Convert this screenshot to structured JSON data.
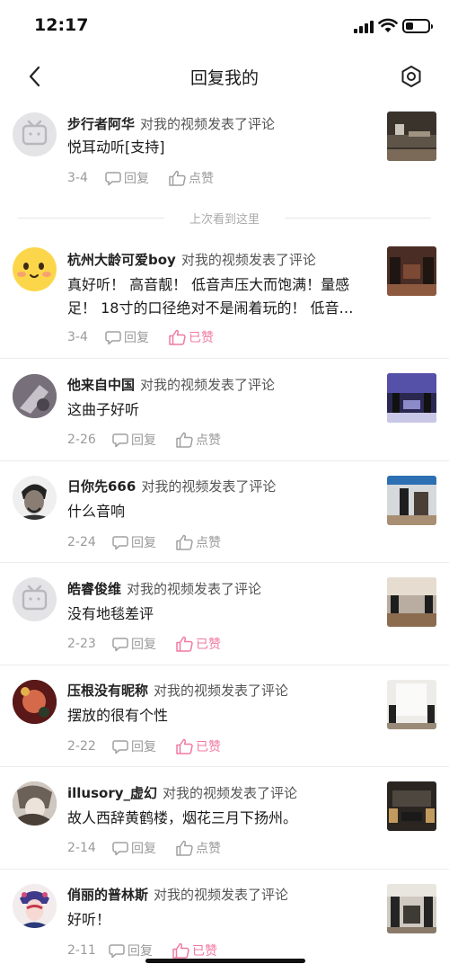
{
  "status_bar": {
    "time": "12:17"
  },
  "nav": {
    "title": "回复我的"
  },
  "divider": {
    "text": "上次看到这里"
  },
  "action_text": "对我的视频发表了评论",
  "reply_label": "回复",
  "like_label": "点赞",
  "liked_label": "已赞",
  "colors": {
    "liked": "#f07aa0",
    "muted": "#9a9a9a"
  },
  "items": [
    {
      "name": "步行者阿华",
      "comment": "悦耳动听[支持]",
      "date": "3-4",
      "liked": false,
      "avatar_icon": "tv-placeholder-icon"
    },
    {
      "name": "杭州大龄可爱boy",
      "comment": "真好听！ 高音靓！ 低音声压大而饱满！量感足！ 18寸的口径绝对不是闹着玩的！ 低音…",
      "date": "3-4",
      "liked": true,
      "avatar_icon": "smiley-face-icon"
    },
    {
      "name": "他来自中国",
      "comment": "这曲子好听",
      "date": "2-26",
      "liked": false,
      "avatar_icon": "photo-avatar"
    },
    {
      "name": "日你先666",
      "comment": "什么音响",
      "date": "2-24",
      "liked": false,
      "avatar_icon": "portrait-avatar"
    },
    {
      "name": "皓睿俊维",
      "comment": "没有地毯差评",
      "date": "2-23",
      "liked": true,
      "avatar_icon": "tv-placeholder-icon"
    },
    {
      "name": "压根没有昵称",
      "comment": "摆放的很有个性",
      "date": "2-22",
      "liked": true,
      "avatar_icon": "photo-avatar"
    },
    {
      "name": "illusory_虚幻",
      "comment": "故人西辞黄鹤楼，烟花三月下扬州。",
      "date": "2-14",
      "liked": false,
      "avatar_icon": "anime-avatar"
    },
    {
      "name": "俏丽的普林斯",
      "comment": "好听！",
      "date": "2-11",
      "liked": true,
      "avatar_icon": "opera-avatar"
    }
  ]
}
